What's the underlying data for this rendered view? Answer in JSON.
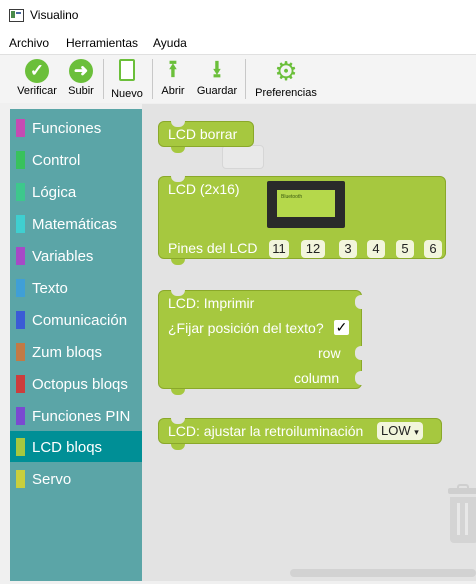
{
  "window": {
    "title": "Visualino",
    "icon": "app-icon"
  },
  "menu": {
    "items": [
      "Archivo",
      "Herramientas",
      "Ayuda"
    ]
  },
  "toolbar": {
    "verify": "Verificar",
    "upload": "Subir",
    "new": "Nuevo",
    "open": "Abrir",
    "save": "Guardar",
    "preferences": "Preferencias"
  },
  "sidebar": {
    "categories": [
      {
        "label": "Funciones",
        "color": "#c54bb3"
      },
      {
        "label": "Control",
        "color": "#38c25c"
      },
      {
        "label": "Lógica",
        "color": "#3dc88c"
      },
      {
        "label": "Matemáticas",
        "color": "#3fcfd0"
      },
      {
        "label": "Variables",
        "color": "#a64ac7"
      },
      {
        "label": "Texto",
        "color": "#3f9fd7"
      },
      {
        "label": "Comunicación",
        "color": "#3b5bd6"
      },
      {
        "label": "Zum bloqs",
        "color": "#c27a45"
      },
      {
        "label": "Octopus bloqs",
        "color": "#cc3d3d"
      },
      {
        "label": "Funciones PIN",
        "color": "#7a4ad1"
      },
      {
        "label": "LCD bloqs",
        "color": "#a6c83f",
        "selected": true
      },
      {
        "label": "Servo",
        "color": "#c9cf3d"
      }
    ]
  },
  "blocks": {
    "lcd_clear": {
      "label": "LCD borrar"
    },
    "lcd_init": {
      "label": "LCD (2x16)",
      "pins_label": "Pines del LCD",
      "pins": [
        "11",
        "12",
        "3",
        "4",
        "5",
        "6"
      ],
      "screen_text": "Bluetooth"
    },
    "lcd_print": {
      "label": "LCD: Imprimir",
      "fix_position_label": "¿Fijar posición del texto?",
      "fix_position_checked": true,
      "check_mark": "✓",
      "row_label": "row",
      "column_label": "column"
    },
    "lcd_backlight": {
      "label": "LCD: ajustar la retroiluminación",
      "value": "LOW",
      "arrow": "▾"
    }
  }
}
